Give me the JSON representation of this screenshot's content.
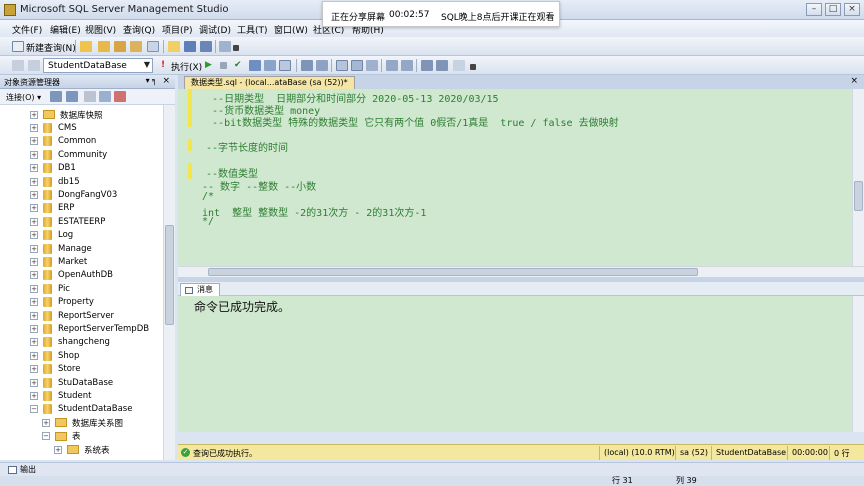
{
  "window": {
    "title": "Microsoft SQL Server Management Studio"
  },
  "share_banner": {
    "status": "正在分享屏幕",
    "time": "00:02:57",
    "notice": "SQL晚上8点后开课正在观看"
  },
  "window_controls": {
    "minimize": "–",
    "maximize": "□",
    "close": "×"
  },
  "menu": {
    "items": [
      "文件(F)",
      "编辑(E)",
      "视图(V)",
      "查询(Q)",
      "项目(P)",
      "调试(D)",
      "工具(T)",
      "窗口(W)",
      "社区(C)",
      "帮助(H)"
    ]
  },
  "toolbar": {
    "new_query": "新建查询(N)",
    "database": "StudentDataBase",
    "execute": "执行(X)"
  },
  "object_explorer": {
    "title": "对象资源管理器",
    "pin": "▾ ╕",
    "close": "×",
    "connect": "连接(O) ▾",
    "items": [
      {
        "label": "数据库快照",
        "kind": "folder",
        "exp": "+"
      },
      {
        "label": "CMS",
        "kind": "db",
        "exp": "+"
      },
      {
        "label": "Common",
        "kind": "db",
        "exp": "+"
      },
      {
        "label": "Community",
        "kind": "db",
        "exp": "+"
      },
      {
        "label": "DB1",
        "kind": "db",
        "exp": "+"
      },
      {
        "label": "db15",
        "kind": "db",
        "exp": "+"
      },
      {
        "label": "DongFangV03",
        "kind": "db",
        "exp": "+"
      },
      {
        "label": "ERP",
        "kind": "db",
        "exp": "+"
      },
      {
        "label": "ESTATEERP",
        "kind": "db",
        "exp": "+"
      },
      {
        "label": "Log",
        "kind": "db",
        "exp": "+"
      },
      {
        "label": "Manage",
        "kind": "db",
        "exp": "+"
      },
      {
        "label": "Market",
        "kind": "db",
        "exp": "+"
      },
      {
        "label": "OpenAuthDB",
        "kind": "db",
        "exp": "+"
      },
      {
        "label": "Pic",
        "kind": "db",
        "exp": "+"
      },
      {
        "label": "Property",
        "kind": "db",
        "exp": "+"
      },
      {
        "label": "ReportServer",
        "kind": "db",
        "exp": "+"
      },
      {
        "label": "ReportServerTempDB",
        "kind": "db",
        "exp": "+"
      },
      {
        "label": "shangcheng",
        "kind": "db",
        "exp": "+"
      },
      {
        "label": "Shop",
        "kind": "db",
        "exp": "+"
      },
      {
        "label": "Store",
        "kind": "db",
        "exp": "+"
      },
      {
        "label": "StuDataBase",
        "kind": "db",
        "exp": "+"
      },
      {
        "label": "Student",
        "kind": "db",
        "exp": "+"
      },
      {
        "label": "StudentDataBase",
        "kind": "db",
        "exp": "−"
      },
      {
        "label": "数据库关系图",
        "kind": "folder",
        "exp": "+"
      },
      {
        "label": "表",
        "kind": "folder",
        "exp": "−"
      },
      {
        "label": "系统表",
        "kind": "folder",
        "exp": "+"
      }
    ]
  },
  "document": {
    "tab": "数据类型.sql - (local...ataBase (sa (52))*",
    "close": "×"
  },
  "editor": {
    "lines": [
      "  --日期类型  日期部分和时间部分 2020-05-13 2020/03/15",
      "  --货币数据类型 money",
      "  --bit数据类型 特殊的数据类型 它只有两个值 0假否/1真是  true / false 去做映射",
      "",
      " --字节长度的时间",
      "",
      " --数值类型",
      "-- 数字 --整数 --小数",
      "/*",
      "int  整型 整数型 -2的31次方 - 2的31次方-1",
      "*/"
    ]
  },
  "results": {
    "tab": "消息",
    "message": "命令已成功完成。"
  },
  "statusbar": {
    "status": "查询已成功执行。",
    "server": "(local) (10.0 RTM)",
    "user": "sa (52)",
    "database": "StudentDataBase",
    "time": "00:00:00",
    "rows": "0 行"
  },
  "output": {
    "tab": "输出"
  },
  "bottom_status": {
    "line": "行 31",
    "col": "列 39"
  }
}
